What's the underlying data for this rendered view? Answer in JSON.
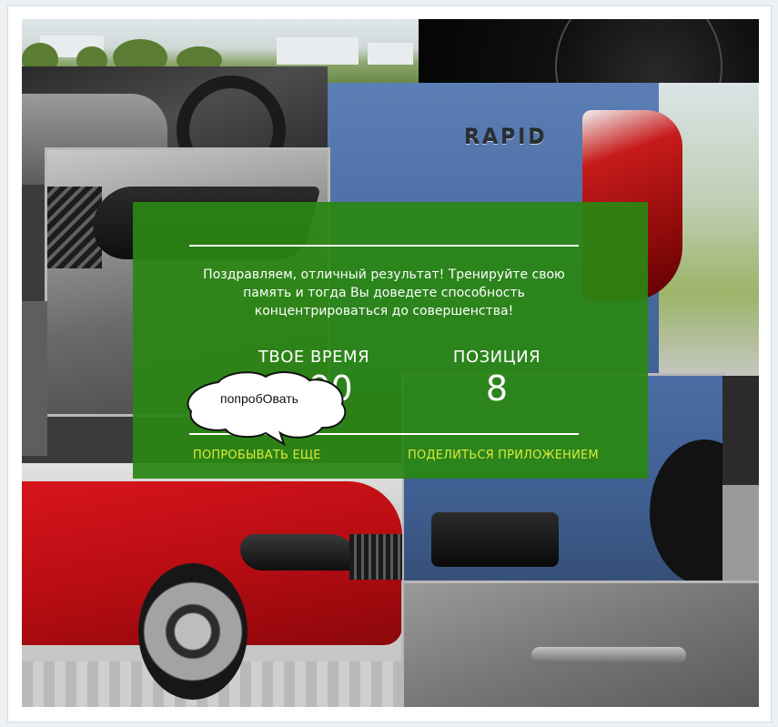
{
  "overlay": {
    "message": "Поздравляем, отличный результат! Тренируйте свою память и тогда Вы доведете способность концентрироваться до совершенства!",
    "time_label": "ТВОЕ ВРЕМЯ",
    "time_value": "90",
    "position_label": "ПОЗИЦИЯ",
    "position_value": "8",
    "retry_link": "ПОПРОБЫВАТЬ ЕЩЕ",
    "share_link": "ПОДЕЛИТЬСЯ ПРИЛОЖЕНИЕМ"
  },
  "collage": {
    "badge_text": "RAPID"
  },
  "bubble": {
    "text": "попробОвать"
  },
  "colors": {
    "panel_green": "#2a8712",
    "link_yellow": "#d8ec3a"
  }
}
